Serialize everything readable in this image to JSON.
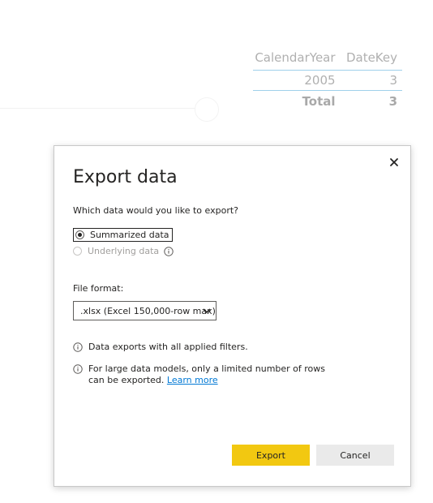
{
  "background_table": {
    "headers": [
      "CalendarYear",
      "DateKey"
    ],
    "rows": [
      [
        "2005",
        "3"
      ]
    ],
    "total": [
      "Total",
      "3"
    ]
  },
  "dialog": {
    "title": "Export data",
    "close_icon": "close-icon",
    "question": "Which data would you like to export?",
    "options": [
      {
        "label": "Summarized data",
        "selected": true,
        "enabled": true
      },
      {
        "label": "Underlying data",
        "selected": false,
        "enabled": false
      }
    ],
    "file_format_label": "File format:",
    "file_format_value": ".xlsx (Excel 150,000-row max)",
    "notes": [
      {
        "text": "Data exports with all applied filters."
      },
      {
        "text": "For large data models, only a limited number of rows can be exported.",
        "link": "Learn more"
      }
    ],
    "buttons": {
      "export": "Export",
      "cancel": "Cancel"
    },
    "colors": {
      "primary": "#f2c811",
      "link": "#0078d4"
    }
  }
}
